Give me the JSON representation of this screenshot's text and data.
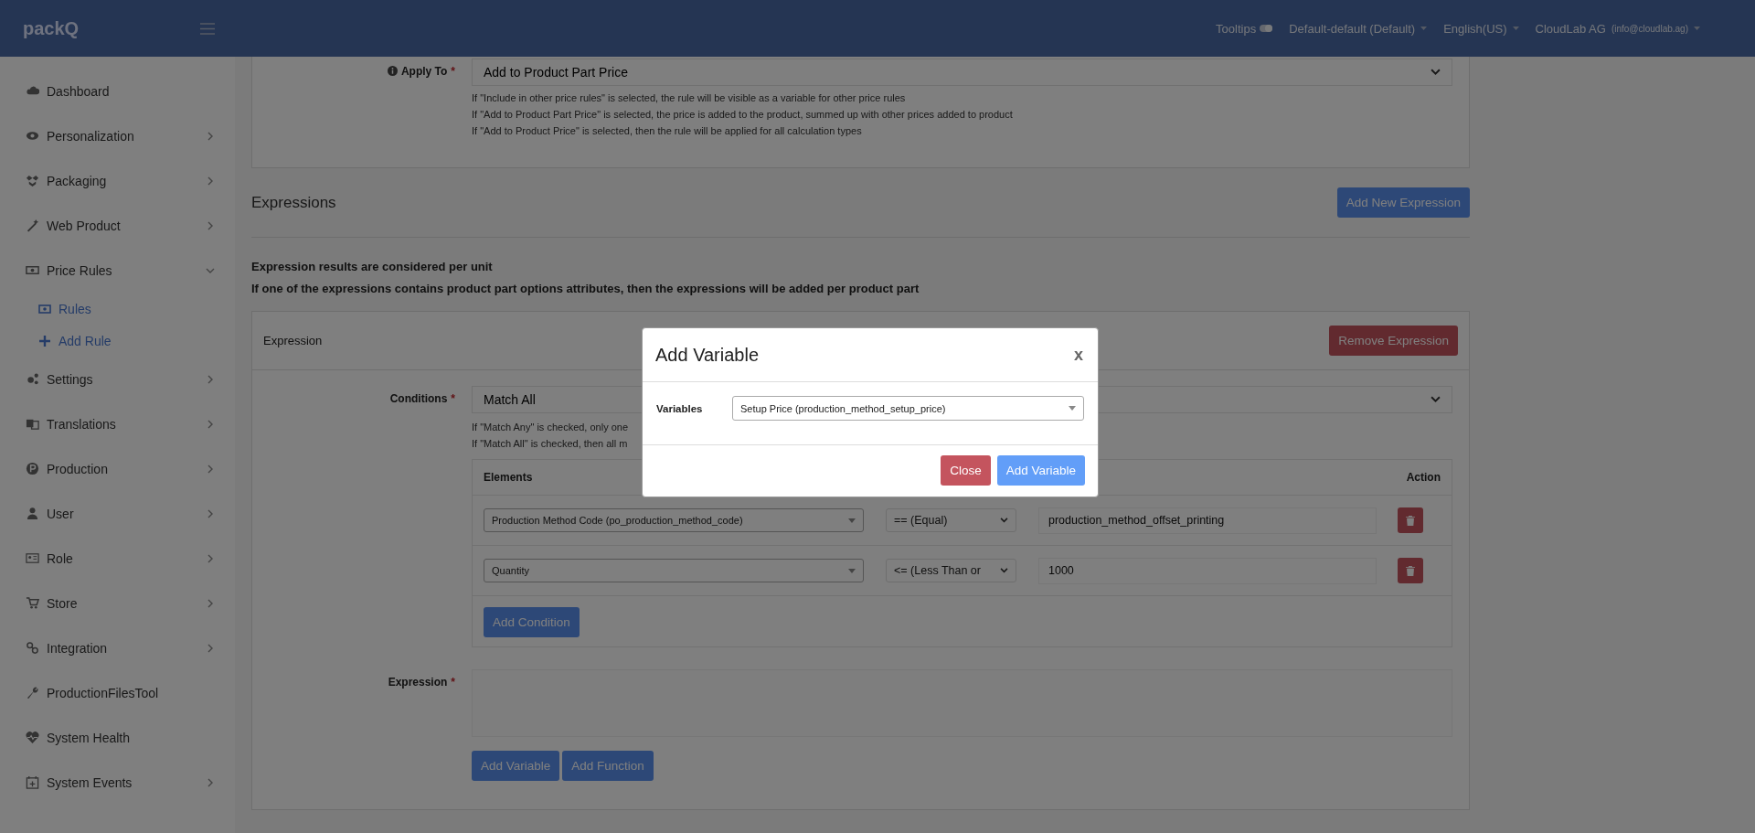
{
  "topbar": {
    "logo": "packQ",
    "tooltips": {
      "label": "Tooltips",
      "on": true
    },
    "menus": [
      {
        "label": "Default-default (Default)"
      },
      {
        "label": "English(US)"
      },
      {
        "label": "CloudLab AG",
        "detail": "(info@cloudlab.ag)"
      }
    ]
  },
  "sidebar": {
    "items": [
      {
        "label": "Dashboard"
      },
      {
        "label": "Personalization",
        "expanded": false
      },
      {
        "label": "Packaging",
        "expanded": false
      },
      {
        "label": "Web Product",
        "expanded": false
      },
      {
        "label": "Price Rules",
        "expanded": true,
        "children": [
          {
            "label": "Rules"
          },
          {
            "label": "Add Rule"
          }
        ]
      },
      {
        "label": "Settings",
        "expanded": false
      },
      {
        "label": "Translations",
        "expanded": false
      },
      {
        "label": "Production",
        "expanded": false
      },
      {
        "label": "User",
        "expanded": false
      },
      {
        "label": "Role",
        "expanded": false
      },
      {
        "label": "Store",
        "expanded": false
      },
      {
        "label": "Integration",
        "expanded": false
      },
      {
        "label": "ProductionFilesTool"
      },
      {
        "label": "System Health"
      },
      {
        "label": "System Events",
        "expanded": false
      }
    ]
  },
  "apply_to": {
    "label": "Apply To",
    "required_mark": "*",
    "value": "Add to Product Part Price",
    "help": [
      "If \"Include in other price rules\" is selected, the rule will be visible as a variable for other price rules",
      "If \"Add to Product Part Price\" is selected, the price is added to the product, summed up with other prices added to product",
      "If \"Add to Product Price\" is selected, then the rule will be applied for all calculation types"
    ]
  },
  "expressions": {
    "title": "Expressions",
    "add_button": "Add New Expression",
    "notes": [
      "Expression results are considered per unit",
      "If one of the expressions contains product part options attributes, then the expressions will be added per product part"
    ],
    "expression": {
      "title": "Expression",
      "remove_button": "Remove Expression",
      "conditions": {
        "label": "Conditions",
        "required_mark": "*",
        "value": "Match All",
        "help": [
          "If \"Match Any\" is checked, only one",
          "If \"Match All\" is checked, then all m"
        ]
      },
      "table": {
        "columns": {
          "elements": "Elements",
          "action": "Action"
        },
        "rows": [
          {
            "element": "Production Method Code (po_production_method_code)",
            "operator": "== (Equal)",
            "value": "production_method_offset_printing"
          },
          {
            "element": "Quantity",
            "operator": "<= (Less Than or",
            "value": "1000"
          }
        ],
        "add_button": "Add Condition"
      },
      "expression_field": {
        "label": "Expression",
        "required_mark": "*"
      },
      "buttons": [
        "Add Variable",
        "Add Function"
      ]
    }
  },
  "modal": {
    "title": "Add Variable",
    "close": "x",
    "field": {
      "label": "Variables",
      "value": "Setup Price (production_method_setup_price)"
    },
    "buttons": [
      {
        "label": "Close",
        "kind": "danger"
      },
      {
        "label": "Add Variable",
        "kind": "primary"
      }
    ]
  }
}
